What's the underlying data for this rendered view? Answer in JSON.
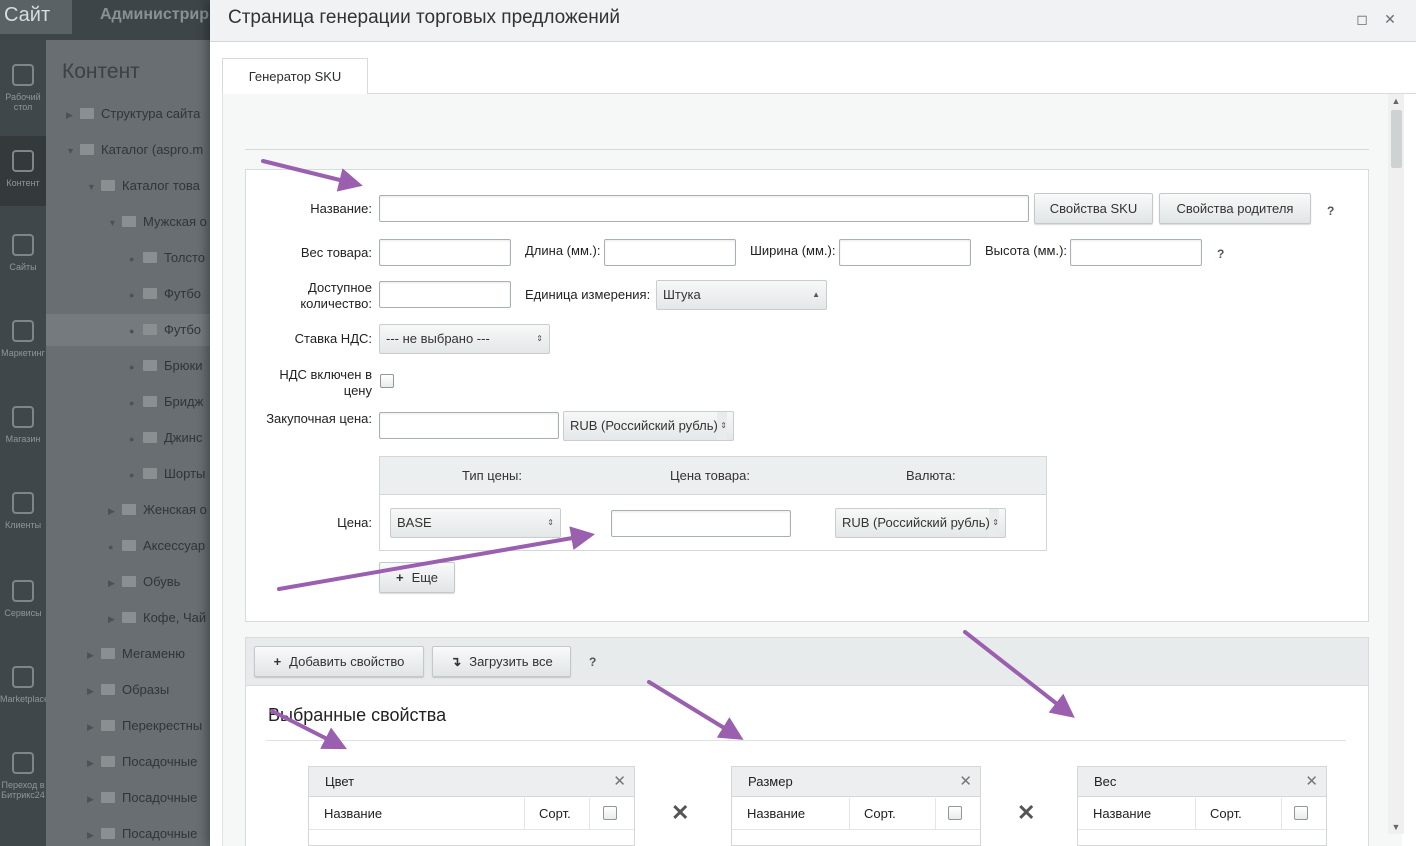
{
  "background": {
    "site_label": "Сайт",
    "admin_label": "Администрир",
    "section_title": "Контент",
    "side_items": [
      {
        "label": "Рабочий стол",
        "icon": "home-icon"
      },
      {
        "label": "Контент",
        "icon": "content-icon"
      },
      {
        "label": "Сайты",
        "icon": "sites-icon"
      },
      {
        "label": "Маркетинг",
        "icon": "target-icon"
      },
      {
        "label": "Магазин",
        "icon": "basket-icon"
      },
      {
        "label": "Клиенты",
        "icon": "clients-icon"
      },
      {
        "label": "Сервисы",
        "icon": "services-icon"
      },
      {
        "label": "Marketplace",
        "icon": "cloud-icon"
      },
      {
        "label": "Переход в Битрикс24",
        "icon": "bitrix-icon"
      }
    ],
    "tree": [
      "Структура сайта",
      "Каталог (aspro.m",
      "Каталог това",
      "Мужская о",
      "Толсто",
      "Футбо",
      "Футбо",
      "Брюки",
      "Бридж",
      "Джинс",
      "Шорты",
      "Женская о",
      "Аксессуар",
      "Обувь",
      "Кофе, Чай",
      "Мегаменю",
      "Образы",
      "Перекрестны",
      "Посадочные",
      "Посадочные",
      "Посадочные"
    ]
  },
  "dialog": {
    "title": "Страница генерации торговых предложений",
    "tab": "Генератор SKU",
    "form": {
      "name_label": "Название:",
      "name_value": "",
      "sku_props_btn": "Свойства SKU",
      "parent_props_btn": "Свойства родителя",
      "help": "?",
      "weight_label": "Вес товара:",
      "length_label": "Длина (мм.):",
      "width_label": "Ширина (мм.):",
      "height_label": "Высота (мм.):",
      "qty_label": "Доступное количество:",
      "unit_label": "Единица измерения:",
      "unit_value": "Штука",
      "vat_label": "Ставка НДС:",
      "vat_value": "--- не выбрано ---",
      "vat_included_label": "НДС включен в цену",
      "purchase_label": "Закупочная цена:",
      "purchase_currency": "RUB (Российский рубль)",
      "price_label": "Цена:",
      "price_type_header": "Тип цены:",
      "price_value_header": "Цена товара:",
      "currency_header": "Валюта:",
      "price_type_value": "BASE",
      "price_currency": "RUB (Российский рубль)",
      "more_btn": "Еще"
    },
    "toolbar": {
      "add_prop_btn": "Добавить свойство",
      "load_all_btn": "Загрузить все",
      "help": "?"
    },
    "selected": {
      "title": "Выбранные свойства",
      "col_name": "Название",
      "col_sort": "Сорт.",
      "props": [
        "Цвет",
        "Размер",
        "Вес"
      ]
    }
  },
  "colors": {
    "arrow": "#9b5fb0",
    "dialog_header": "#f1f2f3"
  }
}
